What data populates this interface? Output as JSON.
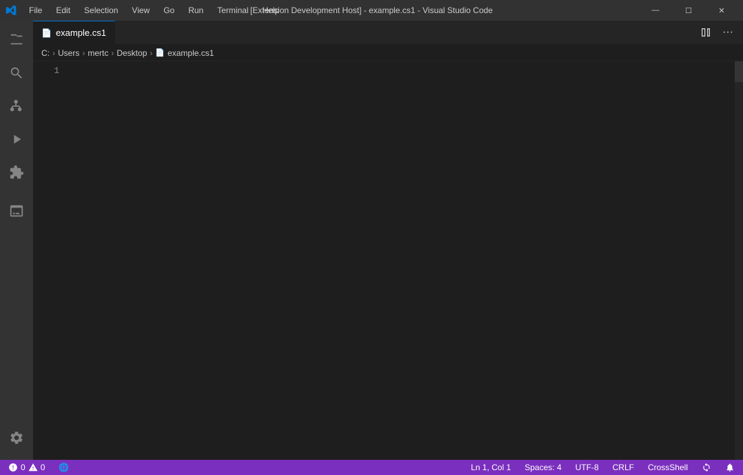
{
  "titlebar": {
    "title": "[Extension Development Host] - example.cs1 - Visual Studio Code",
    "menu": [
      "File",
      "Edit",
      "Selection",
      "View",
      "Go",
      "Run",
      "Terminal",
      "Help"
    ]
  },
  "window_controls": {
    "minimize": "—",
    "maximize": "☐",
    "close": "✕"
  },
  "tabs": [
    {
      "label": "example.cs1",
      "active": true,
      "icon": "📄"
    }
  ],
  "breadcrumb": {
    "parts": [
      "C:",
      "Users",
      "mertc",
      "Desktop",
      "example.cs1"
    ]
  },
  "editor": {
    "line_numbers": [
      "1"
    ],
    "content": ""
  },
  "status_bar": {
    "errors": "0",
    "warnings": "0",
    "language": "",
    "position": "Ln 1, Col 1",
    "spaces": "Spaces: 4",
    "encoding": "UTF-8",
    "line_ending": "CRLF",
    "shell": "CrossShell",
    "globe_icon": "🌐",
    "bell_icon": "🔔",
    "sync_icon": "⟳"
  },
  "activity_bar": {
    "icons": [
      {
        "name": "explorer-icon",
        "symbol": "⎘",
        "active": false
      },
      {
        "name": "search-icon",
        "symbol": "🔍",
        "active": false
      },
      {
        "name": "source-control-icon",
        "symbol": "⑂",
        "active": false
      },
      {
        "name": "run-debug-icon",
        "symbol": "▷",
        "active": false
      },
      {
        "name": "extensions-icon",
        "symbol": "⧉",
        "active": false
      },
      {
        "name": "terminal-icon",
        "symbol": "⌨",
        "active": false
      }
    ],
    "bottom": [
      {
        "name": "settings-icon",
        "symbol": "⚙"
      }
    ]
  }
}
